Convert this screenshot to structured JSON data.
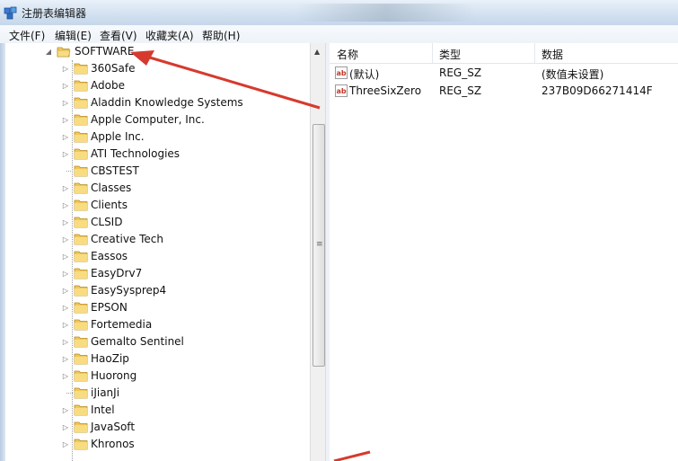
{
  "window": {
    "title": "注册表编辑器"
  },
  "menu": [
    "文件(F)",
    "编辑(E)",
    "查看(V)",
    "收藏夹(A)",
    "帮助(H)"
  ],
  "tree": {
    "parent": "SOFTWARE",
    "children": [
      "360Safe",
      "Adobe",
      "Aladdin Knowledge Systems",
      "Apple Computer, Inc.",
      "Apple Inc.",
      "ATI Technologies",
      "CBSTEST",
      "Classes",
      "Clients",
      "CLSID",
      "Creative Tech",
      "Eassos",
      "EasyDrv7",
      "EasySysprep4",
      "EPSON",
      "Fortemedia",
      "Gemalto Sentinel",
      "HaoZip",
      "Huorong",
      "iJianJi",
      "Intel",
      "JavaSoft",
      "Khronos"
    ]
  },
  "values": {
    "columns": {
      "name": "名称",
      "type": "类型",
      "data": "数据"
    },
    "rows": [
      {
        "name": "(默认)",
        "type": "REG_SZ",
        "data": "(数值未设置)"
      },
      {
        "name": "ThreeSixZero",
        "type": "REG_SZ",
        "data": "237B09D66271414F"
      }
    ]
  },
  "colors": {
    "arrow": "#d63a2e",
    "folder": "#e8b83a",
    "menubar": "#eef3f9"
  }
}
